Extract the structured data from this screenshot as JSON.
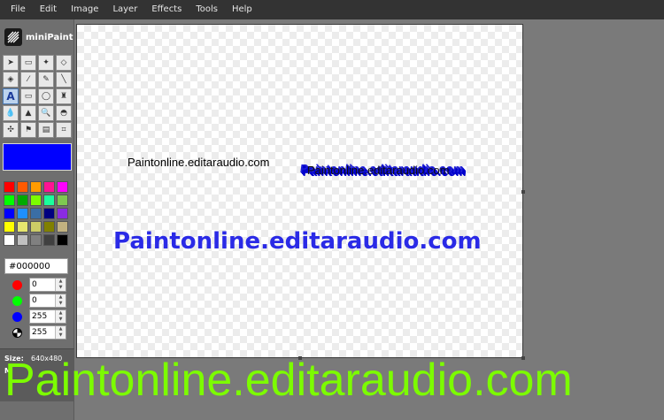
{
  "menu": [
    "File",
    "Edit",
    "Image",
    "Layer",
    "Effects",
    "Tools",
    "Help"
  ],
  "app": {
    "name": "miniPaint"
  },
  "tools": [
    {
      "name": "select-icon",
      "glyph": "➤"
    },
    {
      "name": "marquee-icon",
      "glyph": "▭"
    },
    {
      "name": "magic-wand-icon",
      "glyph": "✦"
    },
    {
      "name": "eraser-icon",
      "glyph": "◇"
    },
    {
      "name": "fill-bucket-icon",
      "glyph": "◈"
    },
    {
      "name": "color-picker-icon",
      "glyph": "⁄"
    },
    {
      "name": "pencil-icon",
      "glyph": "✎"
    },
    {
      "name": "line-icon",
      "glyph": "╲"
    },
    {
      "name": "text-icon",
      "glyph": "A"
    },
    {
      "name": "rectangle-icon",
      "glyph": "▭"
    },
    {
      "name": "ellipse-icon",
      "glyph": "◯"
    },
    {
      "name": "brush-icon",
      "glyph": "♜"
    },
    {
      "name": "blur-icon",
      "glyph": "💧"
    },
    {
      "name": "sharpen-icon",
      "glyph": "▲"
    },
    {
      "name": "zoom-icon",
      "glyph": "🔍"
    },
    {
      "name": "bulge-icon",
      "glyph": "◓"
    },
    {
      "name": "clone-icon",
      "glyph": "✣"
    },
    {
      "name": "deform-icon",
      "glyph": "⚑"
    },
    {
      "name": "gradient-icon",
      "glyph": "▤"
    },
    {
      "name": "crop-icon",
      "glyph": "⌗"
    }
  ],
  "active_tool_index": 8,
  "active_color": "#0000ff",
  "palette": [
    "#ff0000",
    "#ff5a00",
    "#ff9c00",
    "#ff1493",
    "#ff00ff",
    "#00ff00",
    "#00aa00",
    "#7cfc00",
    "#1aff9c",
    "#7ec850",
    "#0000ff",
    "#1e90ff",
    "#3a6ea5",
    "#000080",
    "#8a2be2",
    "#ffff00",
    "#e6e66e",
    "#cccc66",
    "#808000",
    "#c2b280",
    "#ffffff",
    "#c0c0c0",
    "#808080",
    "#404040",
    "#000000"
  ],
  "hex_value": "#000000",
  "channels": [
    {
      "name": "red",
      "color": "#ff0000",
      "value": "0"
    },
    {
      "name": "green",
      "color": "#00ff00",
      "value": "0"
    },
    {
      "name": "blue",
      "color": "#0000ff",
      "value": "255"
    },
    {
      "name": "alpha",
      "color": "#000000",
      "value": "255"
    }
  ],
  "info": {
    "size_label": "Size:",
    "size_value": "640x480",
    "mouse_label": "M"
  },
  "canvas_texts": {
    "small": "Paintonline.editaraudio.com",
    "shadow_back": "Paintonline.editaraudio.com",
    "shadow_front": "Paintonline.editaraudio.com",
    "big": "Paintonline.editaraudio.com"
  },
  "watermark": "Paintonline.editaraudio.com"
}
